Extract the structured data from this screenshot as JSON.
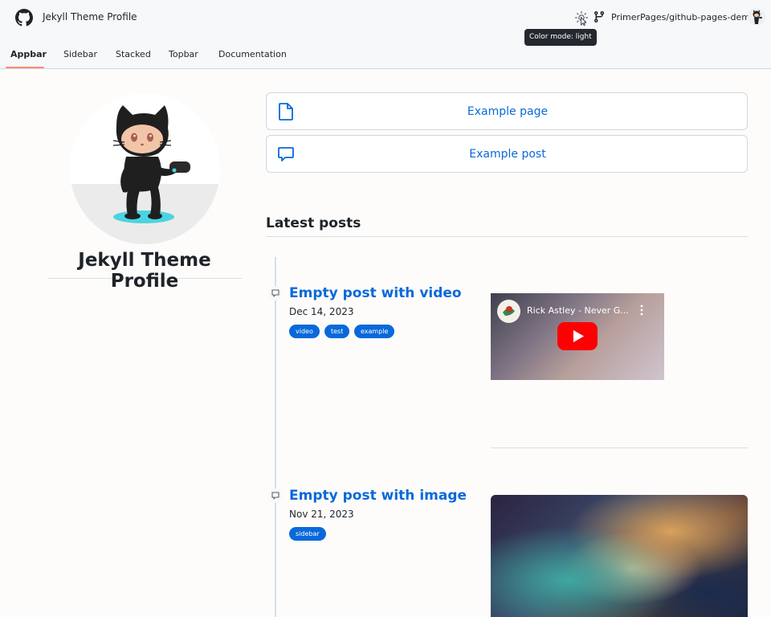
{
  "header": {
    "site_title": "Jekyll Theme Profile",
    "repo_link": "PrimerPages/github-pages-demo",
    "tooltip": "Color mode: light"
  },
  "tabs": [
    "Appbar",
    "Sidebar",
    "Stacked",
    "Topbar",
    "Documentation"
  ],
  "active_tab": "Appbar",
  "profile": {
    "name": "Jekyll Theme Profile"
  },
  "nav_cards": [
    {
      "label": "Example page",
      "icon": "file-icon"
    },
    {
      "label": "Example post",
      "icon": "comment-icon"
    }
  ],
  "latest": {
    "heading": "Latest posts",
    "posts": [
      {
        "title": "Empty post with video",
        "date": "Dec 14, 2023",
        "tags": [
          "video",
          "test",
          "example"
        ],
        "media": {
          "type": "video",
          "title": "Rick Astley - Never G..."
        }
      },
      {
        "title": "Empty post with image",
        "date": "Nov 21, 2023",
        "tags": [
          "sidebar"
        ],
        "media": {
          "type": "image"
        }
      }
    ]
  },
  "colors": {
    "accent": "#0969da",
    "tab_underline": "#fd8c73",
    "youtube_red": "#ff0000"
  }
}
